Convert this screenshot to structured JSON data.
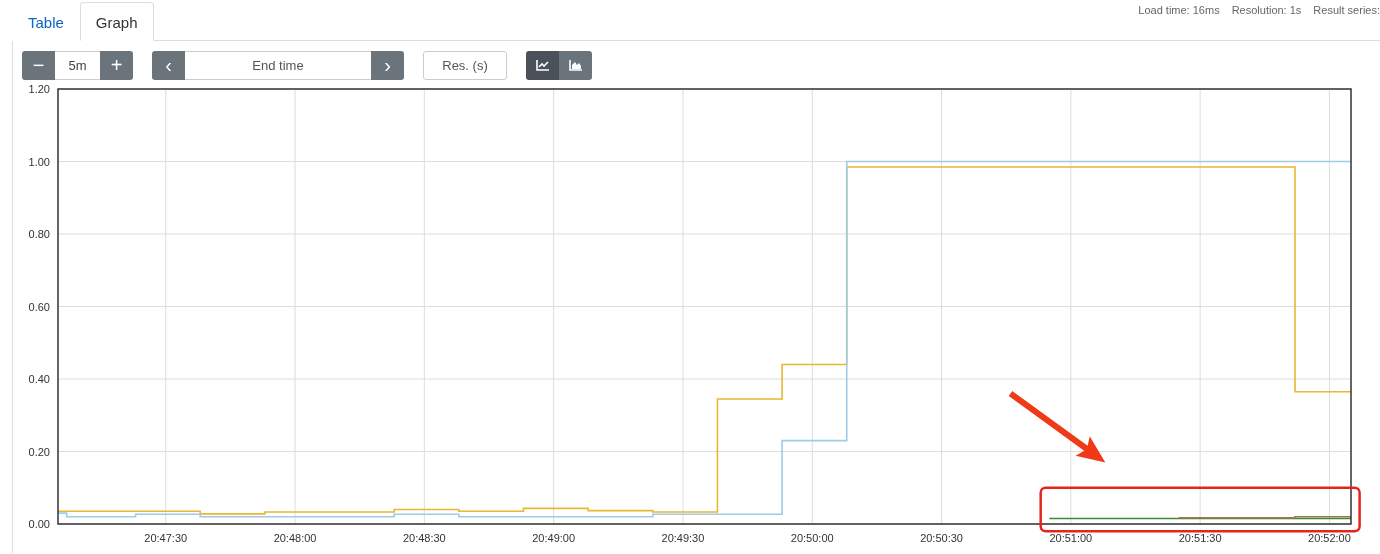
{
  "tabs": [
    {
      "label": "Table",
      "selected": false
    },
    {
      "label": "Graph",
      "selected": true
    }
  ],
  "stats": [
    "Load time: 16ms",
    "Resolution: 1s",
    "Result series:"
  ],
  "controls": {
    "range": "5m",
    "minus": "−",
    "plus": "+",
    "prev": "‹",
    "next": "›",
    "end_time_placeholder": "End time",
    "resolution_placeholder": "Res. (s)",
    "stacked": false
  },
  "graph": {
    "chart_data": {
      "type": "line",
      "grid": true,
      "x": [
        74825,
        74827,
        74827,
        74843,
        74843,
        74858,
        74858,
        74873,
        74873,
        74903,
        74903,
        74918,
        74918,
        74933,
        74933,
        74948,
        74948,
        74963,
        74963,
        74978,
        74978,
        74993,
        74993,
        75008,
        75008,
        75055,
        75085,
        75112,
        75112,
        75125
      ],
      "series": [
        {
          "color": "#e8b833",
          "values": [
            0.035,
            0.035,
            0.035,
            0.035,
            0.035,
            0.035,
            0.028,
            0.028,
            0.033,
            0.033,
            0.04,
            0.04,
            0.035,
            0.035,
            0.043,
            0.043,
            0.037,
            0.037,
            0.033,
            0.033,
            0.345,
            0.345,
            0.44,
            0.44,
            0.985,
            0.985,
            0.985,
            0.985,
            0.365,
            0.365
          ]
        },
        {
          "color": "#9fcbe6",
          "values": [
            0.03,
            0.03,
            0.02,
            0.02,
            0.027,
            0.027,
            0.02,
            0.02,
            0.02,
            0.02,
            0.027,
            0.027,
            0.02,
            0.02,
            0.02,
            0.02,
            0.02,
            0.02,
            0.027,
            0.027,
            0.027,
            0.027,
            0.23,
            0.23,
            1.0,
            1.0,
            1.0,
            1.0,
            1.0,
            1.0
          ]
        },
        {
          "color": "#3a8a3a",
          "values": [
            null,
            null,
            null,
            null,
            null,
            null,
            null,
            null,
            null,
            null,
            null,
            null,
            null,
            null,
            null,
            null,
            null,
            null,
            null,
            null,
            null,
            null,
            null,
            null,
            null,
            0.015,
            0.015,
            0.015,
            0.015,
            0.015
          ]
        },
        {
          "color": "#9a7a45",
          "values": [
            null,
            null,
            null,
            null,
            null,
            null,
            null,
            null,
            null,
            null,
            null,
            null,
            null,
            null,
            null,
            null,
            null,
            null,
            null,
            null,
            null,
            null,
            null,
            null,
            null,
            null,
            0.017,
            0.017,
            0.02,
            0.02
          ]
        }
      ],
      "xlim": [
        74825,
        75125
      ],
      "ylim": [
        0,
        1.2
      ],
      "xticks": [
        {
          "value": 74850,
          "label": "20:47:30"
        },
        {
          "value": 74880,
          "label": "20:48:00"
        },
        {
          "value": 74910,
          "label": "20:48:30"
        },
        {
          "value": 74940,
          "label": "20:49:00"
        },
        {
          "value": 74970,
          "label": "20:49:30"
        },
        {
          "value": 75000,
          "label": "20:50:00"
        },
        {
          "value": 75030,
          "label": "20:50:30"
        },
        {
          "value": 75060,
          "label": "20:51:00"
        },
        {
          "value": 75090,
          "label": "20:51:30"
        },
        {
          "value": 75120,
          "label": "20:52:00"
        }
      ],
      "yticks": [
        {
          "value": 0,
          "label": "0.00"
        },
        {
          "value": 0.2,
          "label": "0.20"
        },
        {
          "value": 0.4,
          "label": "0.40"
        },
        {
          "value": 0.6,
          "label": "0.60"
        },
        {
          "value": 0.8,
          "label": "0.80"
        },
        {
          "value": 1,
          "label": "1.00"
        },
        {
          "value": 1.2,
          "label": "1.20"
        }
      ]
    },
    "markup": [
      {
        "kind": "arrow",
        "color": "#f03a17"
      },
      {
        "kind": "box",
        "color": "#e8231c"
      }
    ]
  }
}
